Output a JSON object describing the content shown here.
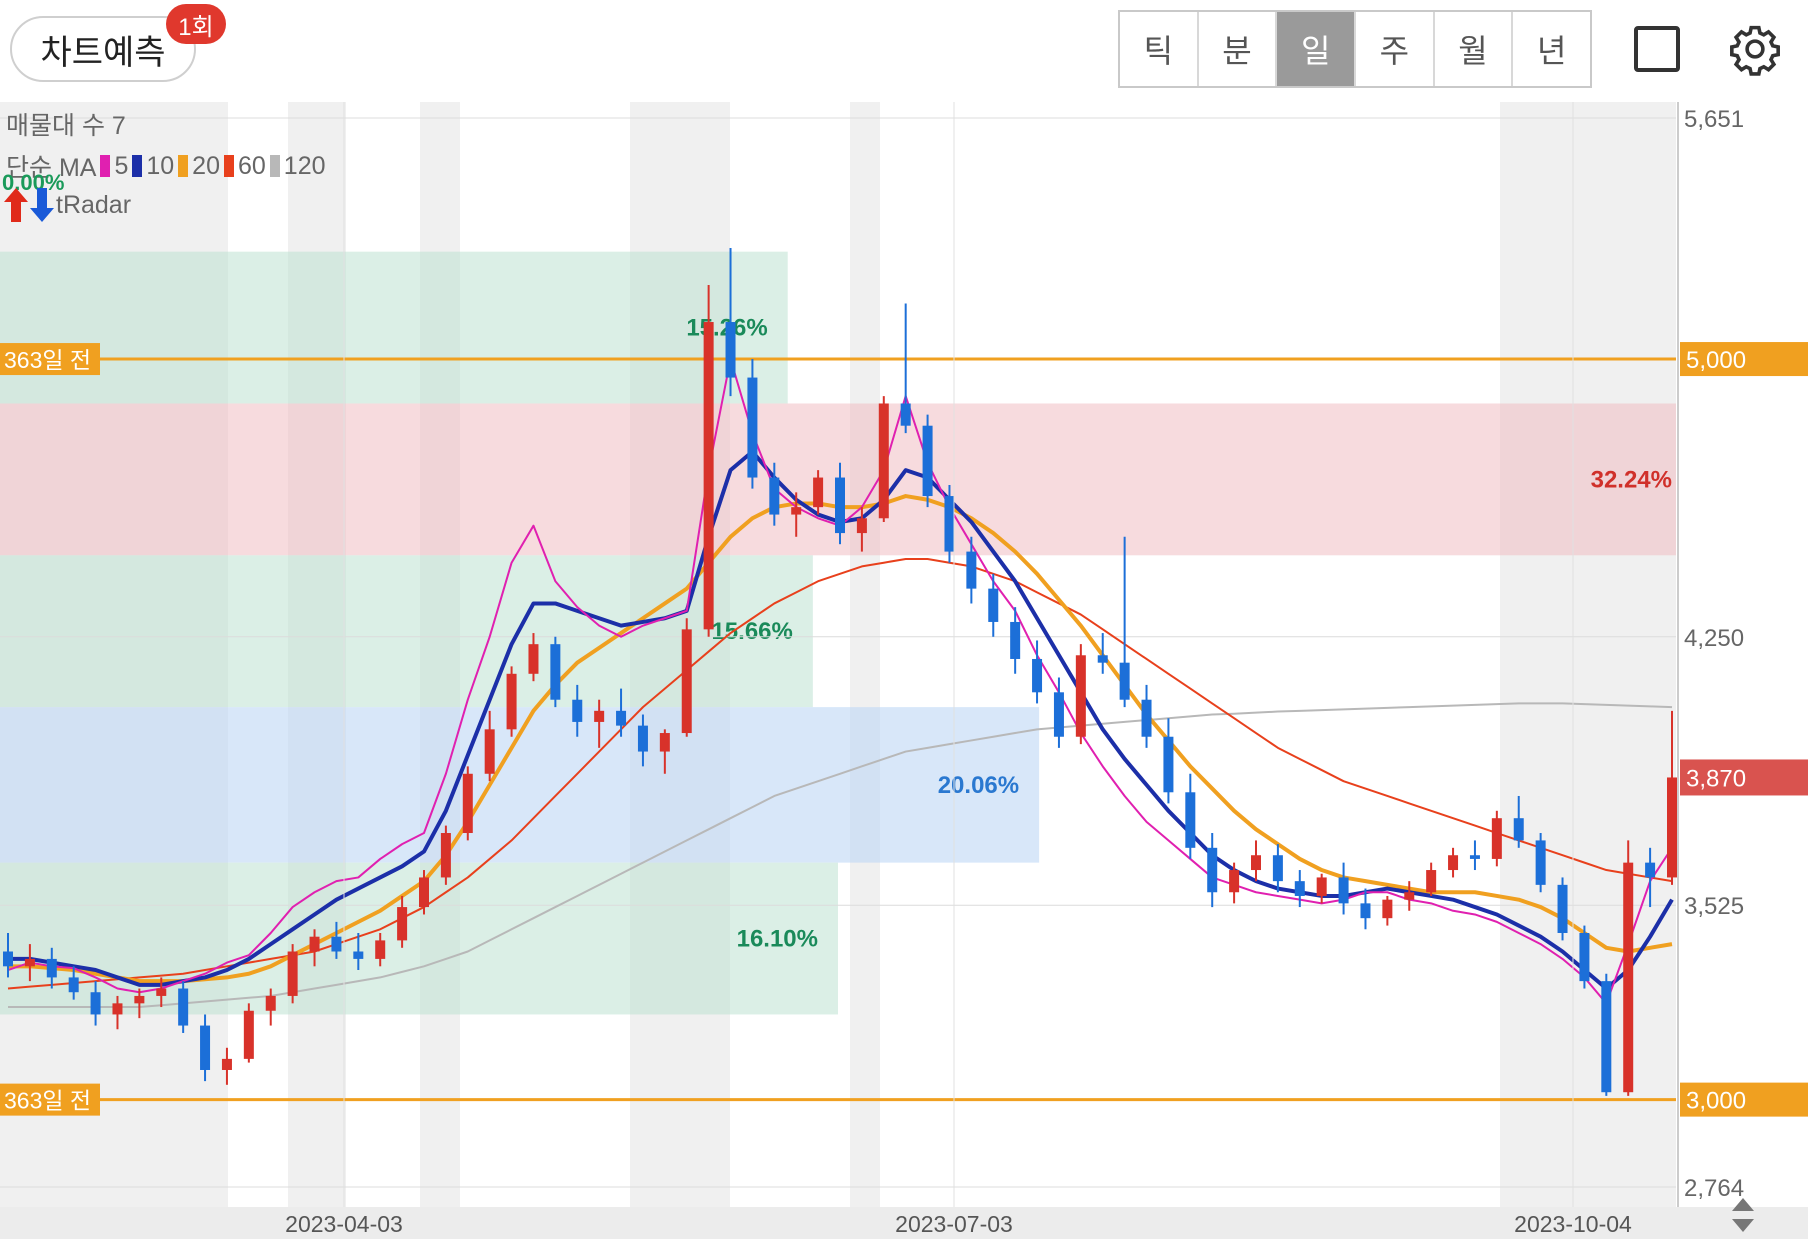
{
  "header": {
    "predict_label": "차트예측",
    "predict_badge": "1회",
    "tabs": [
      {
        "label": "틱",
        "active": false
      },
      {
        "label": "분",
        "active": false
      },
      {
        "label": "일",
        "active": true
      },
      {
        "label": "주",
        "active": false
      },
      {
        "label": "월",
        "active": false
      },
      {
        "label": "년",
        "active": false
      }
    ]
  },
  "legend": {
    "volume_profile": "매물대 수 7",
    "ma_label": "단순 MA",
    "ma_items": [
      {
        "period": "5",
        "color": "#e020b0"
      },
      {
        "period": "10",
        "color": "#1c2fa8"
      },
      {
        "period": "20",
        "color": "#f0a020"
      },
      {
        "period": "60",
        "color": "#e8401c"
      },
      {
        "period": "120",
        "color": "#b8b8b8"
      }
    ],
    "radar_pct": "0.00%",
    "radar_label": "tRadar"
  },
  "chart_data": {
    "type": "candlestick",
    "y_ticks": [
      "5,651",
      "4,250",
      "3,525",
      "2,764"
    ],
    "x_ticks": [
      "2023-04-03",
      "2023-07-03",
      "2023-10-04"
    ],
    "ylim": [
      2764,
      5651
    ],
    "current_price": "3,870",
    "reference_lines": [
      {
        "label": "363일 전",
        "price": "5,000",
        "value": 5000
      },
      {
        "label": "363일 전",
        "price": "3,000",
        "value": 3000
      }
    ],
    "volume_zones": [
      {
        "pct": "15.26%",
        "low": 4880,
        "high": 5290,
        "color": "green",
        "length": 0.47
      },
      {
        "pct": "32.24%",
        "low": 4470,
        "high": 4880,
        "color": "red",
        "length": 1.0
      },
      {
        "pct": "15.66%",
        "low": 4060,
        "high": 4470,
        "color": "green",
        "length": 0.485
      },
      {
        "pct": "20.06%",
        "low": 3640,
        "high": 4060,
        "color": "blue",
        "length": 0.62
      },
      {
        "pct": "16.10%",
        "low": 3230,
        "high": 3640,
        "color": "green",
        "length": 0.5
      }
    ],
    "ma5": [
      3350,
      3370,
      3360,
      3355,
      3330,
      3300,
      3290,
      3300,
      3320,
      3340,
      3370,
      3390,
      3450,
      3520,
      3560,
      3590,
      3600,
      3650,
      3690,
      3720,
      3880,
      4080,
      4250,
      4450,
      4550,
      4400,
      4330,
      4280,
      4250,
      4280,
      4300,
      4320,
      4700,
      5000,
      4800,
      4650,
      4600,
      4570,
      4550,
      4600,
      4700,
      4900,
      4720,
      4600,
      4500,
      4400,
      4320,
      4200,
      4100,
      3990,
      3900,
      3820,
      3750,
      3700,
      3650,
      3600,
      3580,
      3560,
      3550,
      3540,
      3530,
      3540,
      3560,
      3560,
      3540,
      3530,
      3510,
      3500,
      3480,
      3450,
      3420,
      3380,
      3330,
      3260,
      3420,
      3590,
      3680
    ],
    "ma10": [
      3380,
      3380,
      3370,
      3360,
      3350,
      3330,
      3310,
      3310,
      3320,
      3330,
      3350,
      3380,
      3420,
      3460,
      3500,
      3540,
      3570,
      3600,
      3630,
      3670,
      3780,
      3930,
      4080,
      4230,
      4340,
      4340,
      4320,
      4300,
      4280,
      4290,
      4300,
      4320,
      4520,
      4700,
      4750,
      4680,
      4620,
      4580,
      4560,
      4570,
      4620,
      4700,
      4680,
      4620,
      4560,
      4480,
      4400,
      4300,
      4200,
      4100,
      4000,
      3920,
      3850,
      3780,
      3720,
      3660,
      3620,
      3590,
      3570,
      3560,
      3550,
      3550,
      3560,
      3570,
      3560,
      3550,
      3540,
      3520,
      3500,
      3470,
      3440,
      3400,
      3350,
      3300,
      3350,
      3440,
      3540
    ],
    "ma20": [
      3360,
      3360,
      3355,
      3350,
      3340,
      3330,
      3320,
      3320,
      3320,
      3325,
      3330,
      3340,
      3360,
      3390,
      3420,
      3450,
      3480,
      3510,
      3550,
      3590,
      3660,
      3750,
      3850,
      3950,
      4050,
      4120,
      4180,
      4220,
      4260,
      4300,
      4340,
      4380,
      4450,
      4520,
      4570,
      4600,
      4610,
      4610,
      4600,
      4600,
      4610,
      4630,
      4620,
      4600,
      4570,
      4530,
      4480,
      4420,
      4350,
      4280,
      4200,
      4120,
      4040,
      3970,
      3900,
      3840,
      3780,
      3730,
      3690,
      3650,
      3620,
      3600,
      3590,
      3580,
      3570,
      3560,
      3560,
      3560,
      3550,
      3540,
      3520,
      3490,
      3450,
      3410,
      3400,
      3410,
      3420
    ],
    "ma60": [
      3300,
      3305,
      3310,
      3315,
      3320,
      3325,
      3330,
      3335,
      3340,
      3350,
      3360,
      3370,
      3380,
      3390,
      3400,
      3420,
      3440,
      3460,
      3490,
      3520,
      3560,
      3600,
      3650,
      3700,
      3760,
      3820,
      3880,
      3940,
      4000,
      4060,
      4110,
      4160,
      4210,
      4260,
      4300,
      4340,
      4370,
      4400,
      4420,
      4440,
      4450,
      4460,
      4460,
      4450,
      4440,
      4420,
      4400,
      4370,
      4340,
      4310,
      4270,
      4230,
      4190,
      4150,
      4110,
      4070,
      4030,
      3990,
      3950,
      3920,
      3890,
      3860,
      3840,
      3820,
      3800,
      3780,
      3760,
      3740,
      3720,
      3700,
      3680,
      3660,
      3640,
      3620,
      3610,
      3600,
      3590
    ],
    "ma120": [
      3250,
      3250,
      3250,
      3250,
      3250,
      3250,
      3250,
      3255,
      3260,
      3265,
      3270,
      3275,
      3280,
      3290,
      3300,
      3310,
      3320,
      3330,
      3345,
      3360,
      3380,
      3400,
      3430,
      3460,
      3490,
      3520,
      3550,
      3580,
      3610,
      3640,
      3670,
      3700,
      3730,
      3760,
      3790,
      3820,
      3840,
      3860,
      3880,
      3900,
      3920,
      3940,
      3950,
      3960,
      3970,
      3980,
      3990,
      4000,
      4005,
      4010,
      4015,
      4020,
      4025,
      4030,
      4035,
      4040,
      4042,
      4045,
      4048,
      4050,
      4052,
      4054,
      4056,
      4058,
      4060,
      4062,
      4064,
      4066,
      4068,
      4070,
      4070,
      4070,
      4068,
      4066,
      4064,
      4062,
      4060
    ],
    "candles": [
      [
        3400,
        3450,
        3330,
        3360
      ],
      [
        3360,
        3420,
        3320,
        3380
      ],
      [
        3380,
        3410,
        3300,
        3330
      ],
      [
        3330,
        3360,
        3270,
        3290
      ],
      [
        3290,
        3320,
        3200,
        3230
      ],
      [
        3230,
        3280,
        3190,
        3260
      ],
      [
        3260,
        3300,
        3220,
        3280
      ],
      [
        3280,
        3330,
        3250,
        3300
      ],
      [
        3300,
        3320,
        3180,
        3200
      ],
      [
        3200,
        3230,
        3050,
        3080
      ],
      [
        3080,
        3140,
        3040,
        3110
      ],
      [
        3110,
        3260,
        3100,
        3240
      ],
      [
        3240,
        3300,
        3200,
        3280
      ],
      [
        3280,
        3420,
        3260,
        3400
      ],
      [
        3400,
        3460,
        3360,
        3440
      ],
      [
        3440,
        3480,
        3380,
        3400
      ],
      [
        3400,
        3450,
        3350,
        3380
      ],
      [
        3380,
        3450,
        3360,
        3430
      ],
      [
        3430,
        3550,
        3410,
        3520
      ],
      [
        3520,
        3620,
        3500,
        3600
      ],
      [
        3600,
        3740,
        3580,
        3720
      ],
      [
        3720,
        3900,
        3700,
        3880
      ],
      [
        3880,
        4050,
        3860,
        4000
      ],
      [
        4000,
        4170,
        3980,
        4150
      ],
      [
        4150,
        4260,
        4130,
        4230
      ],
      [
        4230,
        4250,
        4060,
        4080
      ],
      [
        4080,
        4120,
        3980,
        4020
      ],
      [
        4020,
        4080,
        3950,
        4050
      ],
      [
        4050,
        4110,
        3980,
        4010
      ],
      [
        4010,
        4040,
        3900,
        3940
      ],
      [
        3940,
        4000,
        3880,
        3990
      ],
      [
        3990,
        4300,
        3980,
        4270
      ],
      [
        4270,
        5200,
        4250,
        5100
      ],
      [
        5100,
        5300,
        4900,
        4950
      ],
      [
        4950,
        5000,
        4650,
        4680
      ],
      [
        4680,
        4720,
        4550,
        4580
      ],
      [
        4580,
        4640,
        4520,
        4600
      ],
      [
        4600,
        4700,
        4580,
        4680
      ],
      [
        4680,
        4720,
        4500,
        4530
      ],
      [
        4530,
        4600,
        4480,
        4570
      ],
      [
        4570,
        4900,
        4560,
        4880
      ],
      [
        4880,
        5150,
        4800,
        4820
      ],
      [
        4820,
        4850,
        4600,
        4630
      ],
      [
        4630,
        4660,
        4450,
        4480
      ],
      [
        4480,
        4520,
        4340,
        4380
      ],
      [
        4380,
        4420,
        4250,
        4290
      ],
      [
        4290,
        4330,
        4150,
        4190
      ],
      [
        4190,
        4240,
        4070,
        4100
      ],
      [
        4100,
        4140,
        3950,
        3980
      ],
      [
        3980,
        4230,
        3960,
        4200
      ],
      [
        4200,
        4260,
        4150,
        4180
      ],
      [
        4180,
        4520,
        4060,
        4080
      ],
      [
        4080,
        4120,
        3950,
        3980
      ],
      [
        3980,
        4030,
        3800,
        3830
      ],
      [
        3830,
        3880,
        3650,
        3680
      ],
      [
        3680,
        3720,
        3520,
        3560
      ],
      [
        3560,
        3640,
        3530,
        3620
      ],
      [
        3620,
        3700,
        3590,
        3660
      ],
      [
        3660,
        3690,
        3560,
        3590
      ],
      [
        3590,
        3620,
        3520,
        3550
      ],
      [
        3550,
        3610,
        3530,
        3600
      ],
      [
        3600,
        3640,
        3500,
        3530
      ],
      [
        3530,
        3570,
        3460,
        3490
      ],
      [
        3490,
        3550,
        3470,
        3540
      ],
      [
        3540,
        3590,
        3510,
        3560
      ],
      [
        3560,
        3640,
        3550,
        3620
      ],
      [
        3620,
        3680,
        3600,
        3660
      ],
      [
        3660,
        3700,
        3620,
        3650
      ],
      [
        3650,
        3780,
        3630,
        3760
      ],
      [
        3760,
        3820,
        3680,
        3700
      ],
      [
        3700,
        3720,
        3560,
        3580
      ],
      [
        3580,
        3600,
        3430,
        3450
      ],
      [
        3450,
        3470,
        3300,
        3320
      ],
      [
        3320,
        3340,
        3010,
        3020
      ],
      [
        3020,
        3700,
        3010,
        3640
      ],
      [
        3640,
        3680,
        3520,
        3600
      ],
      [
        3600,
        4050,
        3580,
        3870
      ]
    ]
  }
}
